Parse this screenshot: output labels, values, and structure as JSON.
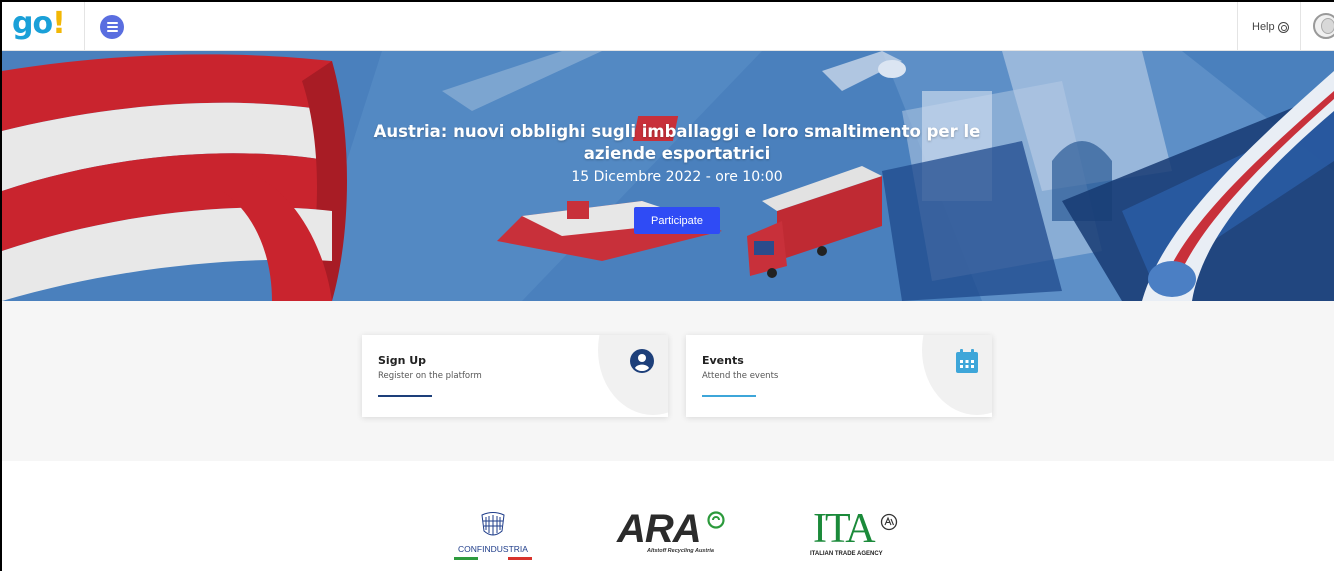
{
  "topbar": {
    "logo": {
      "g": "g",
      "o": "o",
      "bang": "!"
    },
    "help_label": "Help"
  },
  "hero": {
    "title": "Austria: nuovi obblighi sugli imballaggi e loro smaltimento per le aziende esportatrici",
    "date": "15 Dicembre 2022 - ore 10:00",
    "cta_label": "Participate"
  },
  "cards": [
    {
      "title": "Sign Up",
      "subtitle": "Register on the platform",
      "icon": "user-circle-icon",
      "accent": "#1d3f7a"
    },
    {
      "title": "Events",
      "subtitle": "Attend the events",
      "icon": "calendar-icon",
      "accent": "#3ea6d9"
    }
  ],
  "partners": {
    "confindustria": {
      "name": "CONFINDUSTRIA"
    },
    "ara": {
      "name": "ARA",
      "tagline": "Altstoff Recycling Austria"
    },
    "ita": {
      "name": "ITA",
      "tagline": "ITALIAN TRADE AGENCY"
    }
  },
  "colors": {
    "brand_blue": "#1aa0d8",
    "brand_yellow": "#f2b705",
    "menu_button": "#5a6ee0",
    "cta": "#2f4bf5",
    "hero_bg": "#3f77b6"
  }
}
